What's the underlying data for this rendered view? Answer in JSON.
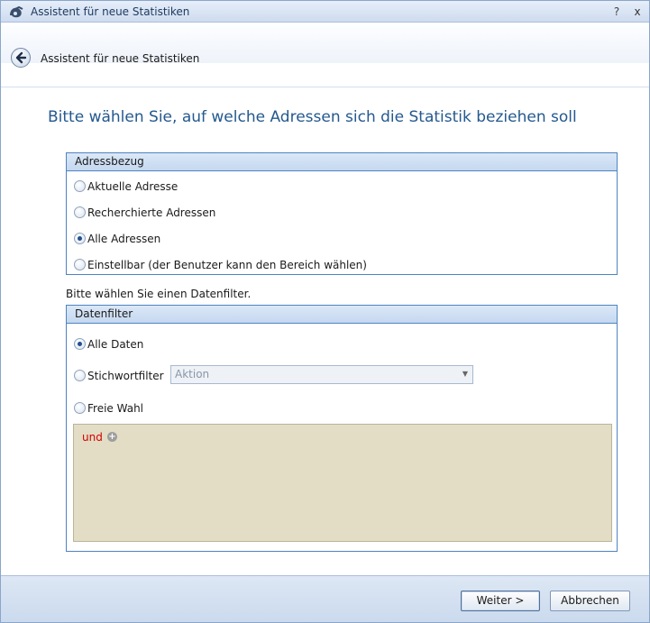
{
  "window": {
    "title": "Assistent für neue Statistiken",
    "help_label": "?",
    "close_label": "x"
  },
  "header": {
    "title": "Assistent für neue Statistiken"
  },
  "main": {
    "heading": "Bitte wählen Sie, auf welche Adressen sich die Statistik beziehen soll"
  },
  "address_group": {
    "title": "Adressbezug",
    "options": [
      {
        "label": "Aktuelle Adresse",
        "checked": false
      },
      {
        "label": "Recherchierte Adressen",
        "checked": false
      },
      {
        "label": "Alle Adressen",
        "checked": true
      },
      {
        "label": "Einstellbar (der Benutzer kann den Bereich wählen)",
        "checked": false
      }
    ]
  },
  "filter_caption": "Bitte wählen Sie einen Datenfilter.",
  "filter_group": {
    "title": "Datenfilter",
    "options": [
      {
        "label": "Alle Daten",
        "checked": true
      },
      {
        "label": "Stichwortfilter",
        "checked": false
      },
      {
        "label": "Freie Wahl",
        "checked": false
      }
    ],
    "keyword_select_value": "Aktion",
    "expression_operator": "und",
    "add_symbol": "+"
  },
  "footer": {
    "next_label": "Weiter >",
    "cancel_label": "Abbrechen"
  }
}
